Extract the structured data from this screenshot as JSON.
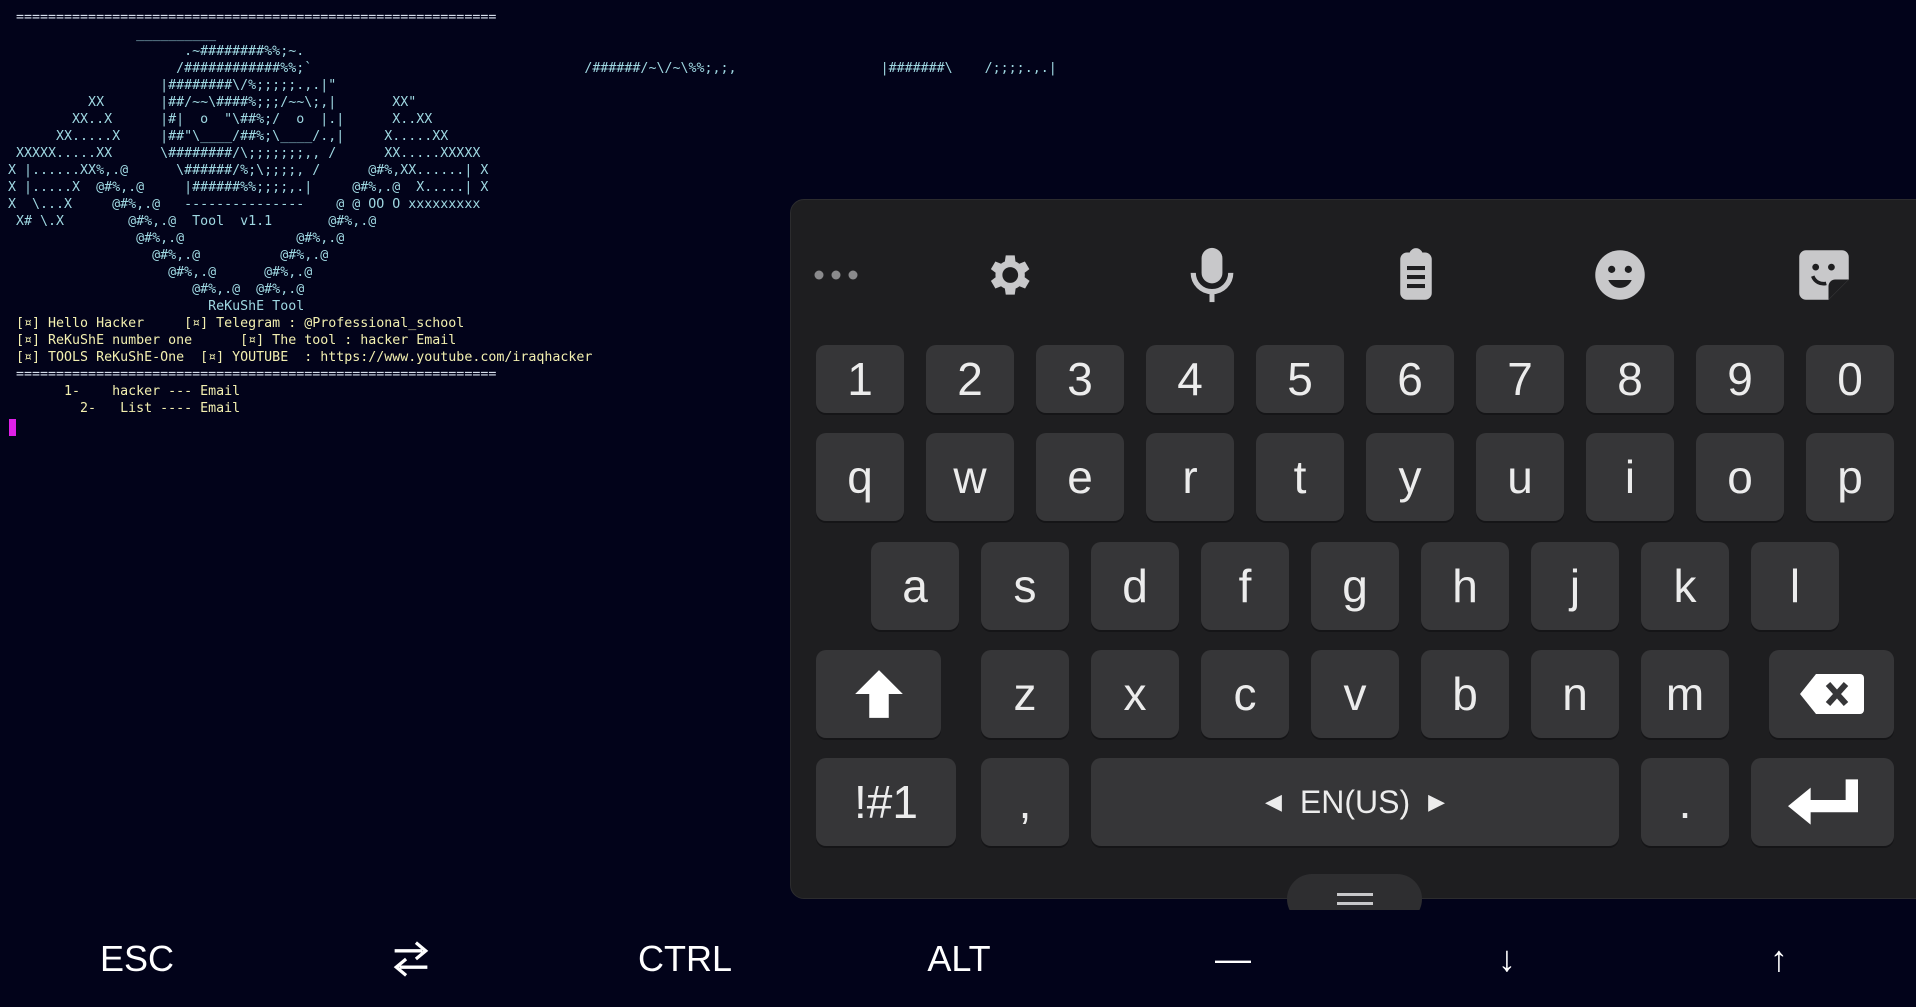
{
  "terminal": {
    "lines": [
      "  ============================================================",
      "                 __________",
      "                       .~########%%;~.",
      "                      /############%%;`                                  /######/~\\/~\\%%;,;,                  |#######\\    /;;;;.,.|",
      "                    |########\\/%;;;;;.,.|\"",
      "           XX       |##/~~\\####%;;;/~~\\;,|       XX\"",
      "         XX..X      |#|  o  \"\\##%;/  o  |.|      X..XX",
      "       XX.....X     |##\"\\____/##%;\\____/.,|     X.....XX",
      "  XXXXX.....XX      \\########/\\;;;;;;;,, /      XX.....XXXXX",
      " X |......XX%,.@      \\######/%;\\;;;;, /      @#%,XX......| X",
      " X |.....X  @#%,.@     |######%%;;;;,.|     @#%,.@  X.....| X",
      " X  \\...X     @#%,.@   ---------------    @ @ OO O xxxxxxxxx",
      "  X# \\.X        @#%,.@  Tool  v1.1       @#%,.@",
      "                 @#%,.@              @#%,.@",
      "                   @#%,.@          @#%,.@",
      "                     @#%,.@      @#%,.@",
      "                        @#%,.@  @#%,.@",
      "                          ReKuShE Tool",
      "  [¤] Hello Hacker     [¤] Telegram : @Professional_school",
      "  [¤] ReKuShE number one      [¤] The tool : hacker Email",
      "  [¤] TOOLS ReKuShE-One  [¤] YOUTUBE  : https://www.youtube.com/iraqhacker",
      "  ============================================================",
      "        1-    hacker --- Email",
      "          2-   List ---- Email"
    ]
  },
  "keyboard": {
    "toolbar": [
      "more-icon",
      "gear-icon",
      "microphone-icon",
      "clipboard-icon",
      "emoji-icon",
      "sticker-icon"
    ],
    "row_numbers": [
      "1",
      "2",
      "3",
      "4",
      "5",
      "6",
      "7",
      "8",
      "9",
      "0"
    ],
    "row_top": [
      "q",
      "w",
      "e",
      "r",
      "t",
      "y",
      "u",
      "i",
      "o",
      "p"
    ],
    "row_home": [
      "a",
      "s",
      "d",
      "f",
      "g",
      "h",
      "j",
      "k",
      "l"
    ],
    "row_bottom": [
      "z",
      "x",
      "c",
      "v",
      "b",
      "n",
      "m"
    ],
    "symbols_label": "!#1",
    "comma_label": ",",
    "space_label": "EN(US)",
    "period_label": "."
  },
  "extra_keys": [
    {
      "label": "ESC",
      "icon": ""
    },
    {
      "label": "",
      "icon": "tab-arrows-icon"
    },
    {
      "label": "CTRL",
      "icon": ""
    },
    {
      "label": "ALT",
      "icon": ""
    },
    {
      "label": "—",
      "icon": ""
    },
    {
      "label": "↓",
      "icon": ""
    },
    {
      "label": "↑",
      "icon": ""
    }
  ],
  "colors": {
    "background": "#02031a",
    "ascii_cyan": "#9fd8e2",
    "info_yellow": "#f3f0b0",
    "cursor": "#e020e8",
    "keyboard_bg": "#1e1e20",
    "key_bg": "#363638"
  }
}
